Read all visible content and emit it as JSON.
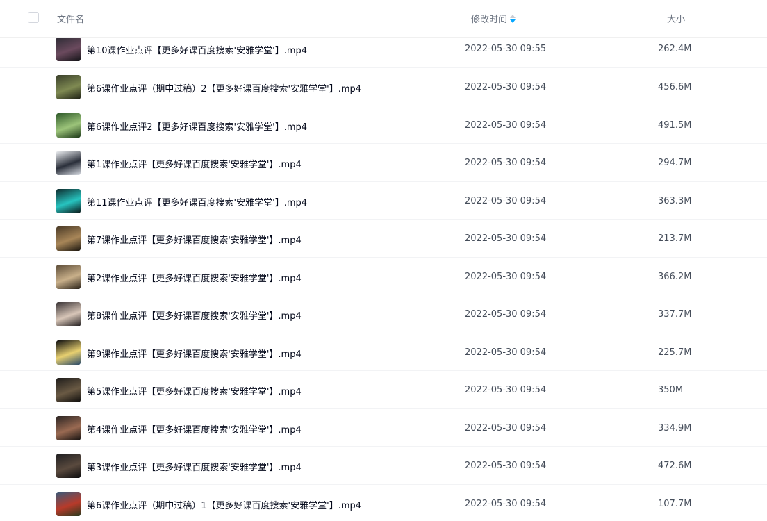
{
  "header": {
    "name_label": "文件名",
    "time_label": "修改时间",
    "size_label": "大小",
    "sort_icon": "sort-descending-icon",
    "sort_accent": "#06a7ff"
  },
  "files": [
    {
      "name": "第10课作业点评【更多好课百度搜索'安雅学堂'】.mp4",
      "time": "2022-05-30 09:55",
      "size": "262.4M",
      "thumb": [
        "#2b2a33",
        "#6b4a5e",
        "#141418"
      ]
    },
    {
      "name": "第6课作业点评（期中过稿）2【更多好课百度搜索'安雅学堂'】.mp4",
      "time": "2022-05-30 09:54",
      "size": "456.6M",
      "thumb": [
        "#3a3f2a",
        "#7f8a52",
        "#1c1e14"
      ]
    },
    {
      "name": "第6课作业点评2【更多好课百度搜索'安雅学堂'】.mp4",
      "time": "2022-05-30 09:54",
      "size": "491.5M",
      "thumb": [
        "#2f5a2a",
        "#9cc47a",
        "#1d3a18"
      ]
    },
    {
      "name": "第1课作业点评【更多好课百度搜索'安雅学堂'】.mp4",
      "time": "2022-05-30 09:54",
      "size": "294.7M",
      "thumb": [
        "#f1f3f6",
        "#2a2f3a",
        "#d9dde4"
      ]
    },
    {
      "name": "第11课作业点评【更多好课百度搜索'安雅学堂'】.mp4",
      "time": "2022-05-30 09:54",
      "size": "363.3M",
      "thumb": [
        "#0d2a2c",
        "#27c4c0",
        "#0a1516"
      ]
    },
    {
      "name": "第7课作业点评【更多好课百度搜索'安雅学堂'】.mp4",
      "time": "2022-05-30 09:54",
      "size": "213.7M",
      "thumb": [
        "#4a3a26",
        "#a88658",
        "#1c1710"
      ]
    },
    {
      "name": "第2课作业点评【更多好课百度搜索'安雅学堂'】.mp4",
      "time": "2022-05-30 09:54",
      "size": "366.2M",
      "thumb": [
        "#5a4a36",
        "#c9b08a",
        "#2a2218"
      ]
    },
    {
      "name": "第8课作业点评【更多好课百度搜索'安雅学堂'】.mp4",
      "time": "2022-05-30 09:54",
      "size": "337.7M",
      "thumb": [
        "#3a3436",
        "#d8c6b8",
        "#1e1a1c"
      ]
    },
    {
      "name": "第9课作业点评【更多好课百度搜索'安雅学堂'】.mp4",
      "time": "2022-05-30 09:54",
      "size": "225.7M",
      "thumb": [
        "#0c0c0e",
        "#e8d070",
        "#2a4a6a"
      ]
    },
    {
      "name": "第5课作业点评【更多好课百度搜索'安雅学堂'】.mp4",
      "time": "2022-05-30 09:54",
      "size": "350M",
      "thumb": [
        "#1e1c1a",
        "#6a5a44",
        "#0e0d0c"
      ]
    },
    {
      "name": "第4课作业点评【更多好课百度搜索'安雅学堂'】.mp4",
      "time": "2022-05-30 09:54",
      "size": "334.9M",
      "thumb": [
        "#2a2422",
        "#9a6a52",
        "#141110"
      ]
    },
    {
      "name": "第3课作业点评【更多好课百度搜索'安雅学堂'】.mp4",
      "time": "2022-05-30 09:54",
      "size": "472.6M",
      "thumb": [
        "#1e1e20",
        "#5a4a3e",
        "#0c0c0e"
      ]
    },
    {
      "name": "第6课作业点评（期中过稿）1【更多好课百度搜索'安雅学堂'】.mp4",
      "time": "2022-05-30 09:54",
      "size": "107.7M",
      "thumb": [
        "#3a5a7a",
        "#b83a2a",
        "#2a3a1e"
      ]
    }
  ]
}
